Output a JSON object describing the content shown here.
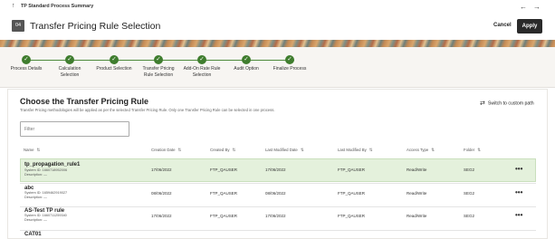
{
  "topbar": {
    "breadcrumb": "TP Standard Process Summary",
    "back": "←",
    "forward": "→",
    "up": "↑"
  },
  "header": {
    "badge": "04",
    "title": "Transfer Pricing Rule Selection",
    "cancel_label": "Cancel",
    "apply_label": "Apply"
  },
  "train": {
    "check": "✓",
    "steps": [
      {
        "label": "Process Details"
      },
      {
        "label": "Calculation Selection"
      },
      {
        "label": "Product Selection"
      },
      {
        "label": "Transfer Pricing Rule Selection"
      },
      {
        "label": "Add-On Rate Rule Selection"
      },
      {
        "label": "Audit Option"
      },
      {
        "label": "Finalize Process"
      }
    ]
  },
  "content": {
    "heading": "Choose the Transfer Pricing Rule",
    "description": "Transfer Pricing methodologies will be applied as per the selected Transfer Pricing Rule. Only one Transfer Pricing Rule can be selected in one process.",
    "switch_label": "Switch to custom path",
    "switch_icon": "⇄",
    "filter_placeholder": "Filter"
  },
  "table": {
    "sort_icon": "⇅",
    "columns": [
      "Name",
      "Creation Date",
      "Created By",
      "Last Modified Date",
      "Last Modified By",
      "Access Type",
      "Folder"
    ],
    "kebab": "•••",
    "rows": [
      {
        "name": "tp_propagation_rule1",
        "system_id": "System ID: 1660718952006",
        "description": "Description: —",
        "creation_date": "17/06/2022",
        "created_by": "FTP_QAUSER",
        "last_modified_date": "17/06/2022",
        "last_modified_by": "FTP_QAUSER",
        "access": "Read/Write",
        "folder": "SEG2"
      },
      {
        "name": "abc",
        "system_id": "System ID: 1659462919027",
        "description": "Description: —",
        "creation_date": "08/06/2022",
        "created_by": "FTP_QAUSER",
        "last_modified_date": "08/06/2022",
        "last_modified_by": "FTP_QAUSER",
        "access": "Read/Write",
        "folder": "SEG2"
      },
      {
        "name": "AS-Test TP rule",
        "system_id": "System ID: 1660711259340",
        "description": "Description: —",
        "creation_date": "17/06/2022",
        "created_by": "FTP_QAUSER",
        "last_modified_date": "17/06/2022",
        "last_modified_by": "FTP_QAUSER",
        "access": "Read/Write",
        "folder": "SEG2"
      },
      {
        "name": "CAT01"
      }
    ]
  }
}
